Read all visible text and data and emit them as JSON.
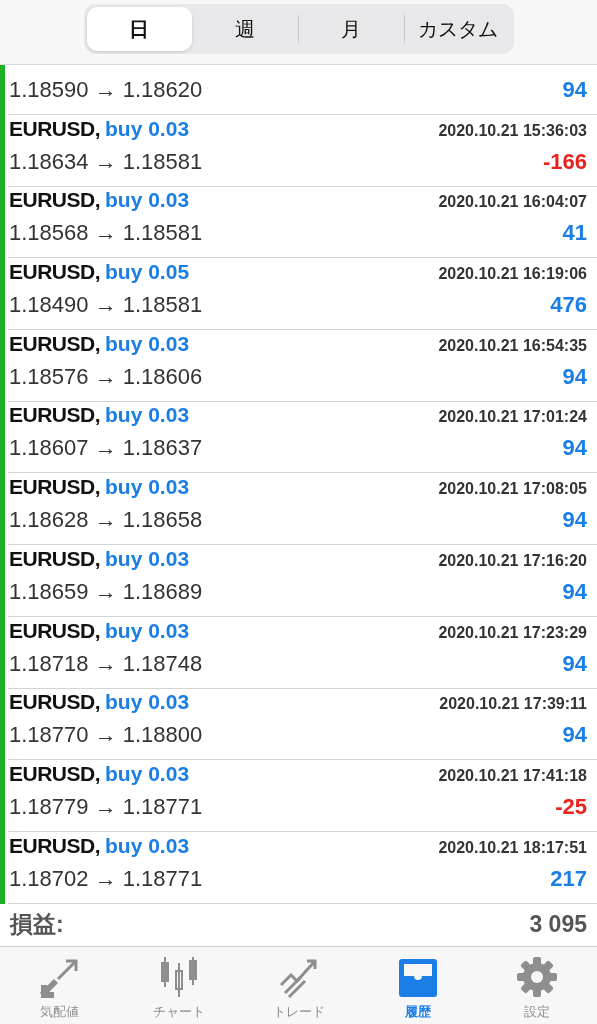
{
  "period_tabs": [
    {
      "label": "日",
      "selected": true
    },
    {
      "label": "週",
      "selected": false
    },
    {
      "label": "月",
      "selected": false
    },
    {
      "label": "カスタム",
      "selected": false
    }
  ],
  "trades": [
    {
      "kind": "cut",
      "prices": "1.18590 → 1.18620",
      "profit": "94",
      "negative": false
    },
    {
      "kind": "full",
      "symbol": "EURUSD,",
      "side": "buy 0.03",
      "time": "2020.10.21 15:36:03",
      "prices": "1.18634 → 1.18581",
      "profit": "-166",
      "negative": true
    },
    {
      "kind": "full",
      "symbol": "EURUSD,",
      "side": "buy 0.03",
      "time": "2020.10.21 16:04:07",
      "prices": "1.18568 → 1.18581",
      "profit": "41",
      "negative": false
    },
    {
      "kind": "full",
      "symbol": "EURUSD,",
      "side": "buy 0.05",
      "time": "2020.10.21 16:19:06",
      "prices": "1.18490 → 1.18581",
      "profit": "476",
      "negative": false
    },
    {
      "kind": "full",
      "symbol": "EURUSD,",
      "side": "buy 0.03",
      "time": "2020.10.21 16:54:35",
      "prices": "1.18576 → 1.18606",
      "profit": "94",
      "negative": false
    },
    {
      "kind": "full",
      "symbol": "EURUSD,",
      "side": "buy 0.03",
      "time": "2020.10.21 17:01:24",
      "prices": "1.18607 → 1.18637",
      "profit": "94",
      "negative": false
    },
    {
      "kind": "full",
      "symbol": "EURUSD,",
      "side": "buy 0.03",
      "time": "2020.10.21 17:08:05",
      "prices": "1.18628 → 1.18658",
      "profit": "94",
      "negative": false
    },
    {
      "kind": "full",
      "symbol": "EURUSD,",
      "side": "buy 0.03",
      "time": "2020.10.21 17:16:20",
      "prices": "1.18659 → 1.18689",
      "profit": "94",
      "negative": false
    },
    {
      "kind": "full",
      "symbol": "EURUSD,",
      "side": "buy 0.03",
      "time": "2020.10.21 17:23:29",
      "prices": "1.18718 → 1.18748",
      "profit": "94",
      "negative": false
    },
    {
      "kind": "full",
      "symbol": "EURUSD,",
      "side": "buy 0.03",
      "time": "2020.10.21 17:39:11",
      "prices": "1.18770 → 1.18800",
      "profit": "94",
      "negative": false
    },
    {
      "kind": "full",
      "symbol": "EURUSD,",
      "side": "buy 0.03",
      "time": "2020.10.21 17:41:18",
      "prices": "1.18779 → 1.18771",
      "profit": "-25",
      "negative": true
    },
    {
      "kind": "full",
      "symbol": "EURUSD,",
      "side": "buy 0.03",
      "time": "2020.10.21 18:17:51",
      "prices": "1.18702 → 1.18771",
      "profit": "217",
      "negative": false
    }
  ],
  "summary": {
    "label": "損益:",
    "value": "3 095"
  },
  "tab_bar": [
    {
      "kind": "quotes",
      "label": "気配値",
      "selected": false
    },
    {
      "kind": "chart",
      "label": "チャート",
      "selected": false
    },
    {
      "kind": "trade",
      "label": "トレード",
      "selected": false
    },
    {
      "kind": "history",
      "label": "履歴",
      "selected": true
    },
    {
      "kind": "settings",
      "label": "設定",
      "selected": false
    }
  ]
}
